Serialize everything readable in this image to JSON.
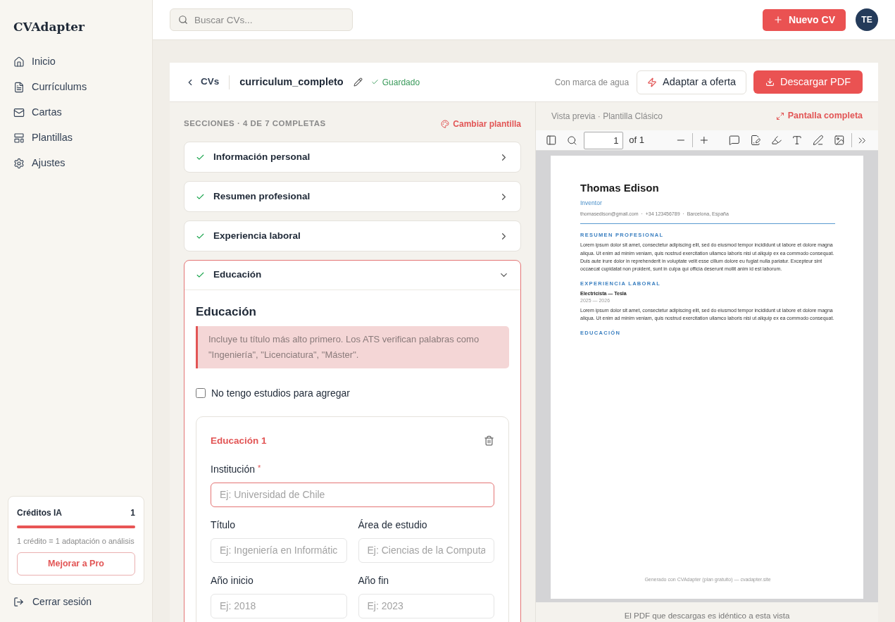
{
  "app": {
    "name": "CVAdapter"
  },
  "sidebar": {
    "items": [
      {
        "label": "Inicio"
      },
      {
        "label": "Currículums"
      },
      {
        "label": "Cartas"
      },
      {
        "label": "Plantillas"
      },
      {
        "label": "Ajustes"
      }
    ],
    "credits": {
      "title": "Créditos IA",
      "count": "1",
      "level": 1,
      "note": "1 crédito = 1 adaptación o análisis",
      "button": "Mejorar a Pro"
    },
    "logout": "Cerrar sesión"
  },
  "topbar": {
    "search": {
      "placeholder": "Buscar CVs..."
    },
    "new_button": "Nuevo CV",
    "avatar": "TE"
  },
  "editor_header": {
    "back": "CVs",
    "filename": "curriculum_completo",
    "status": "Guardado",
    "watermark_note": "Con marca de agua",
    "adapt_button": "Adaptar a oferta",
    "download_button": "Descargar PDF"
  },
  "sections": {
    "heading": "SECCIONES · 4 DE 7 COMPLETAS",
    "change_template": "Cambiar plantilla",
    "items": [
      {
        "label": "Información personal",
        "done": true,
        "expanded": false
      },
      {
        "label": "Resumen profesional",
        "done": true,
        "expanded": false
      },
      {
        "label": "Experiencia laboral",
        "done": true,
        "expanded": false
      },
      {
        "label": "Educación",
        "done": true,
        "expanded": true
      }
    ]
  },
  "education": {
    "title": "Educación",
    "tip": "Incluye tu título más alto primero. Los ATS verifican palabras como \"Ingeniería\", \"Licenciatura\", \"Máster\".",
    "no_studies": {
      "label": "No tengo estudios para agregar",
      "checked": false
    },
    "entry": {
      "title": "Educación 1",
      "fields": [
        {
          "label": "Institución",
          "marker": "*",
          "placeholder": "Ej: Universidad de Chile",
          "invalid": true
        },
        {
          "label": "Título",
          "placeholder": "Ej: Ingeniería en Informátic",
          "invalid": false
        },
        {
          "label": "Área de estudio",
          "placeholder": "Ej: Ciencias de la Computa",
          "invalid": false
        },
        {
          "label": "Año inicio",
          "placeholder": "Ej: 2018",
          "invalid": false
        },
        {
          "label": "Año fin",
          "placeholder": "Ej: 2023",
          "invalid": false
        }
      ]
    }
  },
  "preview": {
    "label": "Vista previa · Plantilla Clásico",
    "fullscreen": "Pantalla completa",
    "toolbar": {
      "page": "1",
      "of": "of 1"
    },
    "document": {
      "name": "Thomas Edison",
      "role": "Inventor",
      "contact": "thomasedison@gmail.com  ·  +34 123456789  ·  Barcelona, España",
      "sections": [
        {
          "title": "RESUMEN PROFESIONAL",
          "entries": [
            {
              "text": "Lorem ipsum dolor sit amet, consectetur adipiscing elit, sed do eiusmod tempor incididunt ut labore et dolore magna aliqua. Ut enim ad minim veniam, quis nostrud exercitation ullamco laboris nisi ut aliquip ex ea commodo consequat. Duis aute irure dolor in reprehenderit in voluptate velit esse cillum dolore eu fugiat nulla pariatur. Excepteur sint occaecat cupidatat non proident, sunt in culpa qui officia deserunt mollit anim id est laborum."
            }
          ]
        },
        {
          "title": "EXPERIENCIA LABORAL",
          "entries": [
            {
              "heading": "Electricista — Tesla",
              "dates": "2025 — 2026",
              "text": "Lorem ipsum dolor sit amet, consectetur adipiscing elit, sed do eiusmod tempor incididunt ut labore et dolore magna aliqua. Ut enim ad minim veniam, quis nostrud exercitation ullamco laboris nisi ut aliquip ex ea commodo consequat."
            }
          ]
        },
        {
          "title": "EDUCACIÓN"
        }
      ],
      "footer": "Generado con CVAdapter (plan gratuito) — cvadapter.site"
    },
    "note": "El PDF que descargas es idéntico a esta vista"
  }
}
